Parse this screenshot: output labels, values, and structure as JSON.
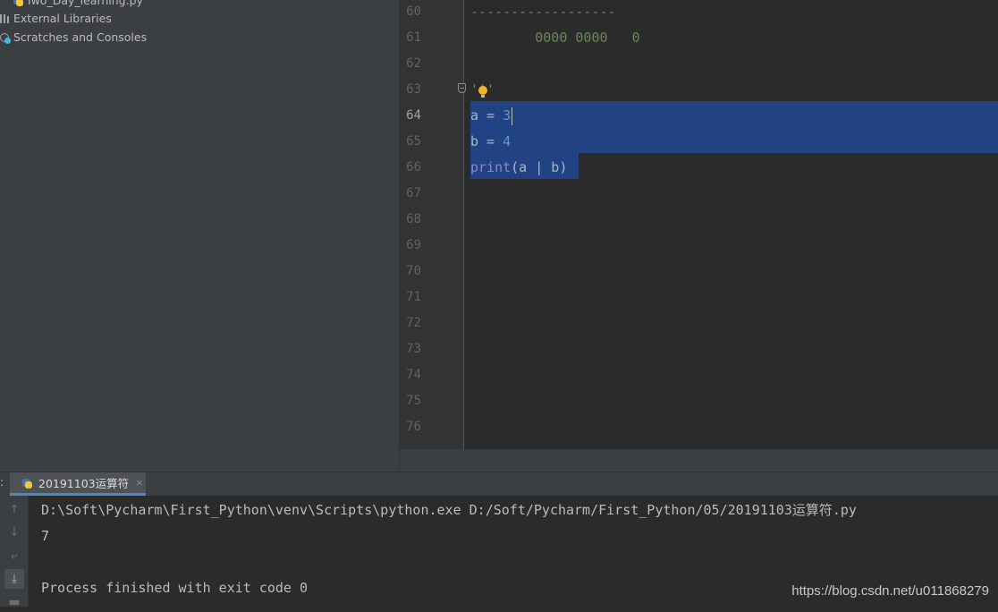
{
  "sidebar": {
    "items": [
      {
        "label": "Two_Day_learning.py"
      },
      {
        "label": "External Libraries"
      },
      {
        "label": "Scratches and Consoles"
      }
    ]
  },
  "editor": {
    "line_numbers": [
      "60",
      "61",
      "62",
      "63",
      "64",
      "65",
      "66",
      "67",
      "68",
      "69",
      "70",
      "71",
      "72",
      "73",
      "74",
      "75",
      "76"
    ],
    "current_line": "64",
    "code": {
      "l60": "------------------",
      "l61": "        0000 0000   0",
      "l63": "'''",
      "l64_var": "a",
      "l64_op": " = ",
      "l64_num": "3",
      "l65_var": "b",
      "l65_op": " = ",
      "l65_num": "4",
      "l66_fn": "print",
      "l66_args": "(a | b)"
    }
  },
  "run": {
    "panel_label": ":",
    "tab_label": "20191103运算符",
    "tab_close": "×",
    "console": [
      "D:\\Soft\\Pycharm\\First_Python\\venv\\Scripts\\python.exe D:/Soft/Pycharm/First_Python/05/20191103运算符.py",
      "7",
      "",
      "Process finished with exit code 0"
    ]
  },
  "watermark": "https://blog.csdn.net/u011868279",
  "colors": {
    "selection": "#214283",
    "string": "#6a8759",
    "number": "#6897bb",
    "builtin": "#8888c6",
    "accent_tab": "#4a88c7"
  },
  "icons": [
    "python-file-icon",
    "library-icon",
    "scratches-icon",
    "bulb-icon",
    "fold-icon",
    "up-arrow-icon",
    "down-arrow-icon",
    "soft-wrap-icon",
    "scroll-to-end-icon",
    "print-icon"
  ]
}
